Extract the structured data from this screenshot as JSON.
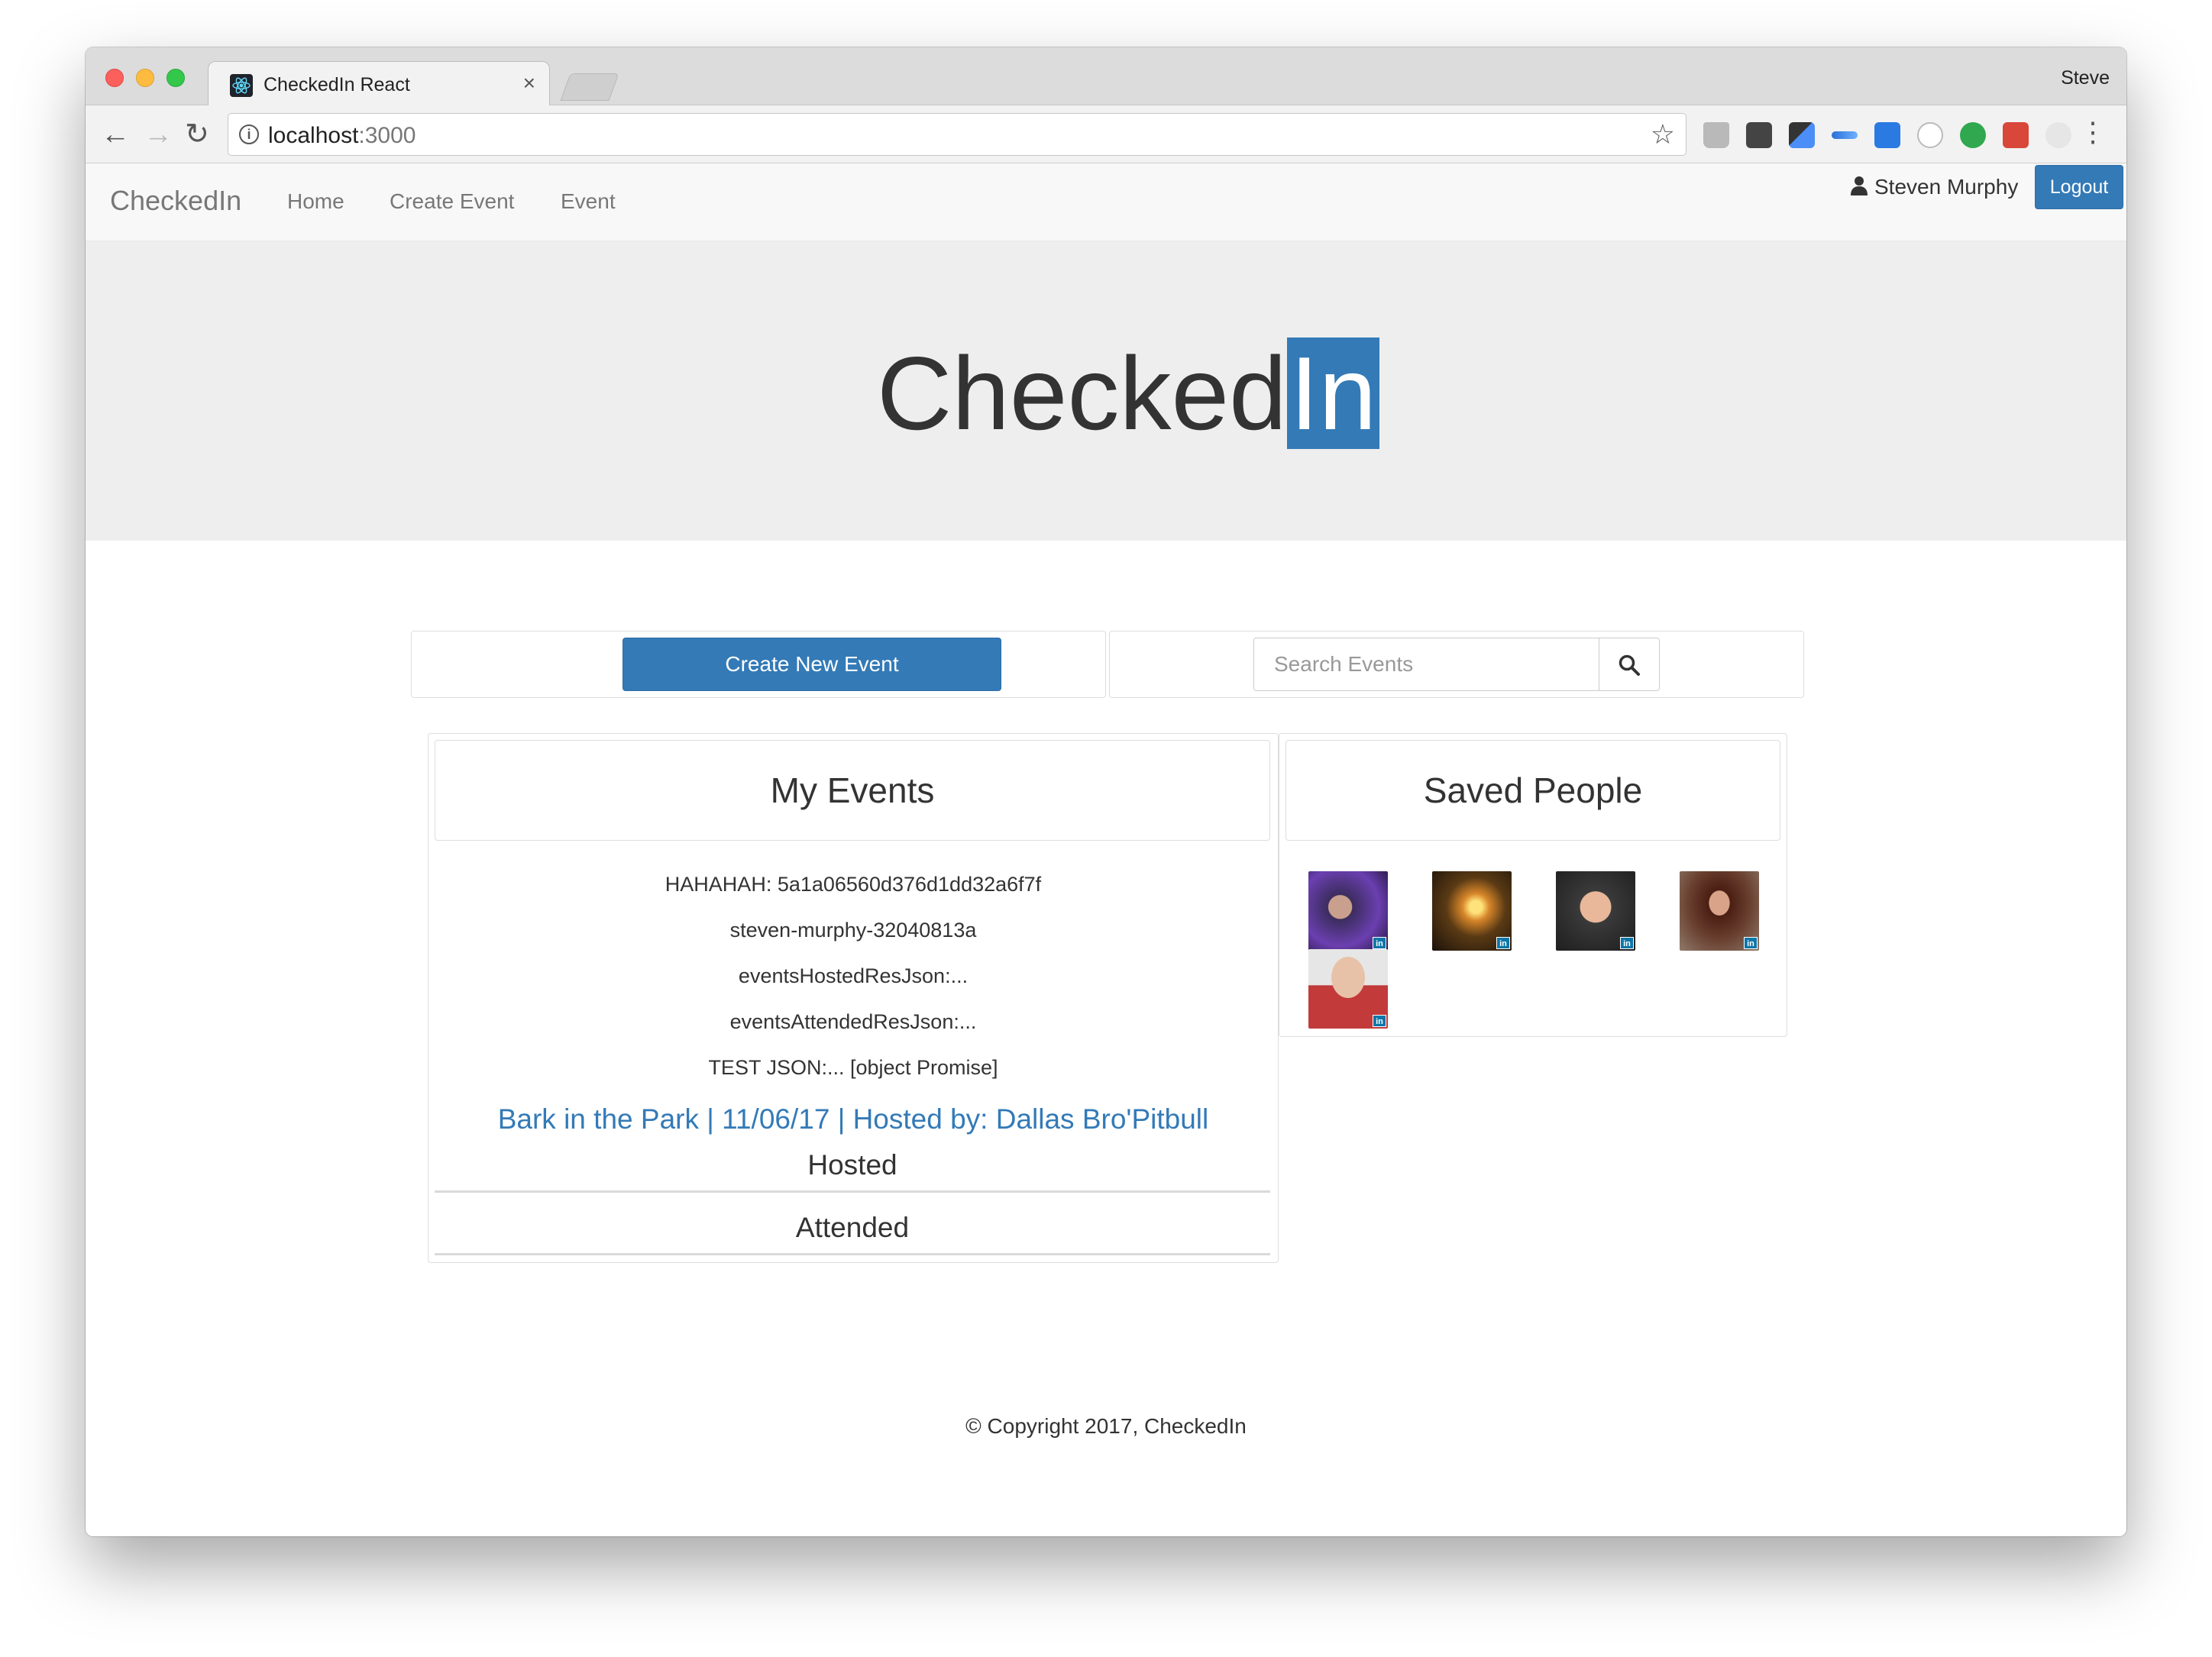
{
  "browser": {
    "tab_title": "CheckedIn React",
    "tab_close": "×",
    "profile": "Steve",
    "url_host": "localhost",
    "url_port": ":3000",
    "back": "←",
    "forward": "→",
    "reload": "↻",
    "info": "i",
    "star": "☆",
    "menu": "⋮",
    "extension_icons": [
      "drive-icon",
      "ghostery-icon",
      "dropper-icon",
      "arrows-icon",
      "skype-icon",
      "circle-icon",
      "search-ext-icon",
      "red-ext-icon",
      "gear-ext-icon"
    ]
  },
  "navbar": {
    "brand": "CheckedIn",
    "links": [
      "Home",
      "Create Event",
      "Event"
    ],
    "user_name": "Steven Murphy",
    "logout": "Logout"
  },
  "hero": {
    "logo_text": "Checked",
    "logo_highlight": "In",
    "accent_color": "#337ab7"
  },
  "actions": {
    "create_button": "Create New Event",
    "search_placeholder": "Search Events"
  },
  "my_events": {
    "title": "My Events",
    "lines": [
      "HAHAHAH: 5a1a06560d376d1dd32a6f7f",
      "steven-murphy-32040813a",
      "eventsHostedResJson:...",
      "eventsAttendedResJson:...",
      "TEST JSON:... [object Promise]"
    ],
    "event_link": "Bark in the Park | 11/06/17 | Hosted by: Dallas Bro'Pitbull",
    "hosted_label": "Hosted",
    "attended_label": "Attended"
  },
  "saved_people": {
    "title": "Saved People",
    "count": 5,
    "badge": "in"
  },
  "footer": {
    "copyright": "© Copyright 2017, CheckedIn"
  }
}
